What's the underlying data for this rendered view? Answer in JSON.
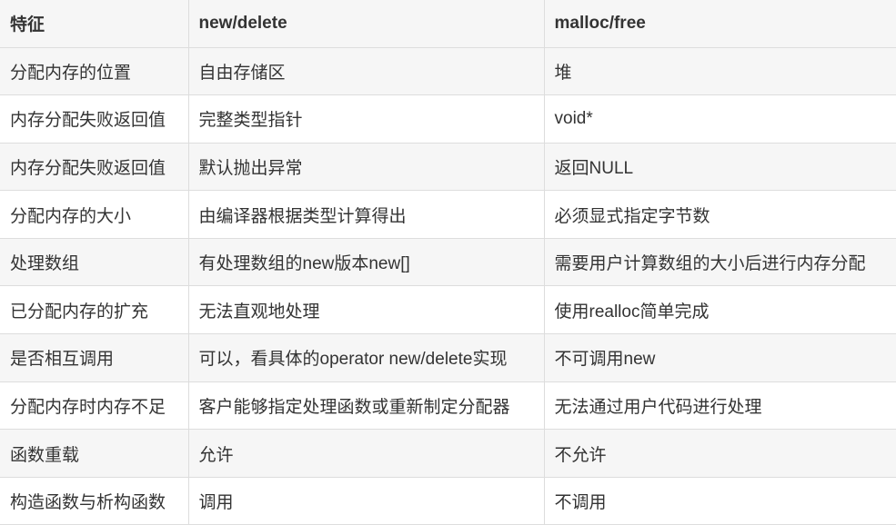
{
  "headers": [
    "特征",
    "new/delete",
    "malloc/free"
  ],
  "rows": [
    [
      "分配内存的位置",
      "自由存储区",
      "堆"
    ],
    [
      "内存分配失败返回值",
      "完整类型指针",
      "void*"
    ],
    [
      "内存分配失败返回值",
      "默认抛出异常",
      "返回NULL"
    ],
    [
      "分配内存的大小",
      "由编译器根据类型计算得出",
      "必须显式指定字节数"
    ],
    [
      "处理数组",
      "有处理数组的new版本new[]",
      "需要用户计算数组的大小后进行内存分配"
    ],
    [
      "已分配内存的扩充",
      "无法直观地处理",
      "使用realloc简单完成"
    ],
    [
      "是否相互调用",
      "可以，看具体的operator new/delete实现",
      "不可调用new"
    ],
    [
      "分配内存时内存不足",
      "客户能够指定处理函数或重新制定分配器",
      "无法通过用户代码进行处理"
    ],
    [
      "函数重载",
      "允许",
      "不允许"
    ],
    [
      "构造函数与析构函数",
      "调用",
      "不调用"
    ]
  ]
}
